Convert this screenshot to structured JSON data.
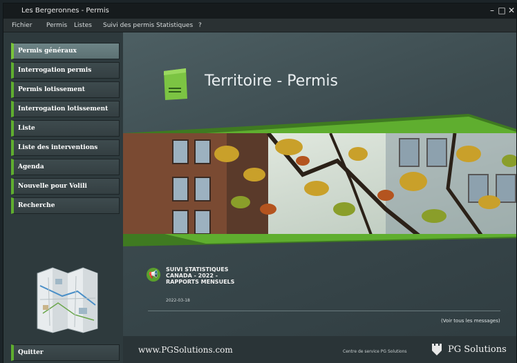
{
  "window": {
    "title": "Les Bergeronnes - Permis",
    "minimize": "–",
    "maximize": "□",
    "close": "✕"
  },
  "menu": [
    "Fichier",
    "Permis",
    "Listes",
    "Suivi des permis",
    "Statistiques",
    "?"
  ],
  "sidebar": {
    "items": [
      "Permis généraux",
      "Interrogation permis",
      "Permis lotissement",
      "Interrogation lotissement",
      "Liste",
      "Liste des interventions",
      "Agenda",
      "Nouvelle pour Volili",
      "Recherche"
    ],
    "quit": "Quitter"
  },
  "main": {
    "title": "Territoire - Permis"
  },
  "news": {
    "title": "SUIVI STATISTIQUES\nCANADA - 2022 -\nRAPPORTS MENSUELS",
    "date": "2022-03-18",
    "view_all": "(Voir tous les messages)"
  },
  "footer": {
    "url": "www.PGSolutions.com",
    "service": "Centre de service PG Solutions",
    "brand": "PG Solutions"
  },
  "colors": {
    "accent_green": "#5fae2f",
    "active_button": "#6d8486"
  }
}
